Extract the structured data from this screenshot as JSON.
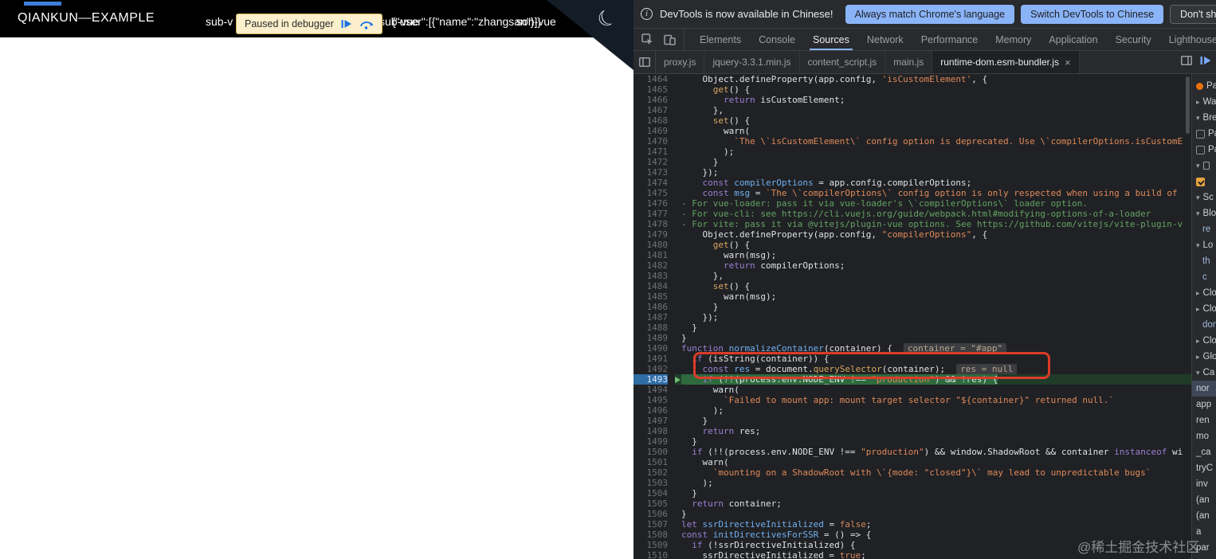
{
  "page": {
    "title": "QIANKUN—EXAMPLE",
    "nav_left": "sub-v",
    "overlap_texts": [
      "sub-vue",
      "{\"user\":[{\"name\":\"zhangsan\"}]}",
      "son-vue"
    ],
    "paused_banner": {
      "text": "Paused in debugger"
    }
  },
  "icons": {
    "close_icon": "×",
    "moon_icon": "☾",
    "info_icon": "i",
    "chevron_down": "▾",
    "chevron_right": "▸"
  },
  "devtools": {
    "infobar": {
      "message": "DevTools is now available in Chinese!",
      "buttons": [
        {
          "label": "Always match Chrome's language",
          "style": "primary"
        },
        {
          "label": "Switch DevTools to Chinese",
          "style": "primary"
        },
        {
          "label": "Don't show again",
          "style": "secondary"
        }
      ]
    },
    "main_tabs": {
      "items": [
        "Elements",
        "Console",
        "Sources",
        "Network",
        "Performance",
        "Memory",
        "Application",
        "Security",
        "Lighthouse"
      ],
      "selected": "Sources"
    },
    "file_tabs": [
      {
        "label": "proxy.js"
      },
      {
        "label": "jquery-3.3.1.min.js"
      },
      {
        "label": "content_script.js"
      },
      {
        "label": "main.js"
      },
      {
        "label": "runtime-dom.esm-bundler.js",
        "active": true,
        "closable": true
      }
    ],
    "editor": {
      "lines": [
        {
          "n": 1464,
          "s": [
            [
              "pl",
              "    Object.defineProperty(app.config, "
            ],
            [
              "str",
              "'isCustomElement'"
            ],
            [
              "pl",
              ", {"
            ]
          ]
        },
        {
          "n": 1465,
          "s": [
            [
              "pl",
              "      "
            ],
            [
              "prop",
              "get"
            ],
            [
              "pl",
              "() {"
            ]
          ]
        },
        {
          "n": 1466,
          "s": [
            [
              "pl",
              "        "
            ],
            [
              "kw",
              "return"
            ],
            [
              "pl",
              " isCustomElement;"
            ]
          ]
        },
        {
          "n": 1467,
          "s": [
            [
              "pl",
              "      },"
            ]
          ]
        },
        {
          "n": 1468,
          "s": [
            [
              "pl",
              "      "
            ],
            [
              "prop",
              "set"
            ],
            [
              "pl",
              "() {"
            ]
          ]
        },
        {
          "n": 1469,
          "s": [
            [
              "pl",
              "        warn("
            ]
          ]
        },
        {
          "n": 1470,
          "s": [
            [
              "pl",
              "          "
            ],
            [
              "str",
              "`The \\`isCustomElement\\` config option is deprecated. Use \\`compilerOptions.isCustomE"
            ]
          ]
        },
        {
          "n": 1471,
          "s": [
            [
              "pl",
              "        );"
            ]
          ]
        },
        {
          "n": 1472,
          "s": [
            [
              "pl",
              "      }"
            ]
          ]
        },
        {
          "n": 1473,
          "s": [
            [
              "pl",
              "    });"
            ]
          ]
        },
        {
          "n": 1474,
          "s": [
            [
              "pl",
              "    "
            ],
            [
              "kw",
              "const"
            ],
            [
              "pl",
              " "
            ],
            [
              "def",
              "compilerOptions"
            ],
            [
              "pl",
              " = app.config.compilerOptions;"
            ]
          ]
        },
        {
          "n": 1475,
          "s": [
            [
              "pl",
              "    "
            ],
            [
              "kw",
              "const"
            ],
            [
              "pl",
              " "
            ],
            [
              "def",
              "msg"
            ],
            [
              "pl",
              " = "
            ],
            [
              "str",
              "`The \\`compilerOptions\\` config option is only respected when using a build of"
            ]
          ]
        },
        {
          "n": 1476,
          "s": [
            [
              "grn",
              "- For vue-loader: pass it via vue-loader's \\`compilerOptions\\` loader option."
            ]
          ]
        },
        {
          "n": 1477,
          "s": [
            [
              "grn",
              "- For vue-cli: see https://cli.vuejs.org/guide/webpack.html#modifying-options-of-a-loader"
            ]
          ]
        },
        {
          "n": 1478,
          "s": [
            [
              "grn",
              "- For vite: pass it via @vitejs/plugin-vue options. See https://github.com/vitejs/vite-plugin-v"
            ]
          ]
        },
        {
          "n": 1479,
          "s": [
            [
              "pl",
              "    Object.defineProperty(app.config, "
            ],
            [
              "str",
              "\"compilerOptions\""
            ],
            [
              "pl",
              ", {"
            ]
          ]
        },
        {
          "n": 1480,
          "s": [
            [
              "pl",
              "      "
            ],
            [
              "prop",
              "get"
            ],
            [
              "pl",
              "() {"
            ]
          ]
        },
        {
          "n": 1481,
          "s": [
            [
              "pl",
              "        warn(msg);"
            ]
          ]
        },
        {
          "n": 1482,
          "s": [
            [
              "pl",
              "        "
            ],
            [
              "kw",
              "return"
            ],
            [
              "pl",
              " compilerOptions;"
            ]
          ]
        },
        {
          "n": 1483,
          "s": [
            [
              "pl",
              "      },"
            ]
          ]
        },
        {
          "n": 1484,
          "s": [
            [
              "pl",
              "      "
            ],
            [
              "prop",
              "set"
            ],
            [
              "pl",
              "() {"
            ]
          ]
        },
        {
          "n": 1485,
          "s": [
            [
              "pl",
              "        warn(msg);"
            ]
          ]
        },
        {
          "n": 1486,
          "s": [
            [
              "pl",
              "      }"
            ]
          ]
        },
        {
          "n": 1487,
          "s": [
            [
              "pl",
              "    });"
            ]
          ]
        },
        {
          "n": 1488,
          "s": [
            [
              "pl",
              "  }"
            ]
          ]
        },
        {
          "n": 1489,
          "s": [
            [
              "pl",
              "}"
            ]
          ]
        },
        {
          "n": 1490,
          "s": [
            [
              "kw",
              "function"
            ],
            [
              "pl",
              " "
            ],
            [
              "def",
              "normalizeContainer"
            ],
            [
              "pl",
              "(container) {"
            ],
            [
              "ev",
              "container = \"#app\""
            ]
          ]
        },
        {
          "n": 1491,
          "s": [
            [
              "pl",
              "  "
            ],
            [
              "kw",
              "if"
            ],
            [
              "pl",
              " (isString(container)) {"
            ]
          ]
        },
        {
          "n": 1492,
          "s": [
            [
              "pl",
              "    "
            ],
            [
              "kw",
              "const"
            ],
            [
              "pl",
              " "
            ],
            [
              "def",
              "res"
            ],
            [
              "pl",
              " = document."
            ],
            [
              "prop",
              "querySelector"
            ],
            [
              "pl",
              "(container);"
            ],
            [
              "ev",
              "res = null"
            ]
          ]
        },
        {
          "n": 1493,
          "exec": true,
          "s": [
            [
              "pl",
              "    "
            ],
            [
              "kw",
              "if"
            ],
            [
              "pl",
              " (!!(process.env.NODE_ENV !== "
            ],
            [
              "str",
              "\"production\""
            ],
            [
              "pl",
              ") && !res) {"
            ]
          ]
        },
        {
          "n": 1494,
          "s": [
            [
              "pl",
              "      warn("
            ]
          ]
        },
        {
          "n": 1495,
          "s": [
            [
              "pl",
              "        "
            ],
            [
              "str",
              "`Failed to mount app: mount target selector \"${container}\" returned null.`"
            ]
          ]
        },
        {
          "n": 1496,
          "s": [
            [
              "pl",
              "      );"
            ]
          ]
        },
        {
          "n": 1497,
          "s": [
            [
              "pl",
              "    }"
            ]
          ]
        },
        {
          "n": 1498,
          "s": [
            [
              "pl",
              "    "
            ],
            [
              "kw",
              "return"
            ],
            [
              "pl",
              " res;"
            ]
          ]
        },
        {
          "n": 1499,
          "s": [
            [
              "pl",
              "  }"
            ]
          ]
        },
        {
          "n": 1500,
          "s": [
            [
              "pl",
              "  "
            ],
            [
              "kw",
              "if"
            ],
            [
              "pl",
              " (!!(process.env.NODE_ENV !== "
            ],
            [
              "str",
              "\"production\""
            ],
            [
              "pl",
              ") && window.ShadowRoot && container "
            ],
            [
              "kw",
              "instanceof"
            ],
            [
              "pl",
              " wi"
            ]
          ]
        },
        {
          "n": 1501,
          "s": [
            [
              "pl",
              "    warn("
            ]
          ]
        },
        {
          "n": 1502,
          "s": [
            [
              "pl",
              "      "
            ],
            [
              "str",
              "`mounting on a ShadowRoot with \\`{mode: \"closed\"}\\` may lead to unpredictable bugs`"
            ]
          ]
        },
        {
          "n": 1503,
          "s": [
            [
              "pl",
              "    );"
            ]
          ]
        },
        {
          "n": 1504,
          "s": [
            [
              "pl",
              "  }"
            ]
          ]
        },
        {
          "n": 1505,
          "s": [
            [
              "pl",
              "  "
            ],
            [
              "kw",
              "return"
            ],
            [
              "pl",
              " container;"
            ]
          ]
        },
        {
          "n": 1506,
          "s": [
            [
              "pl",
              "}"
            ]
          ]
        },
        {
          "n": 1507,
          "s": [
            [
              "kw",
              "let"
            ],
            [
              "pl",
              " "
            ],
            [
              "def",
              "ssrDirectiveInitialized"
            ],
            [
              "pl",
              " = "
            ],
            [
              "atom",
              "false"
            ],
            [
              "pl",
              ";"
            ]
          ]
        },
        {
          "n": 1508,
          "s": [
            [
              "kw",
              "const"
            ],
            [
              "pl",
              " "
            ],
            [
              "def",
              "initDirectivesForSSR"
            ],
            [
              "pl",
              " = () => {"
            ]
          ]
        },
        {
          "n": 1509,
          "s": [
            [
              "pl",
              "  "
            ],
            [
              "kw",
              "if"
            ],
            [
              "pl",
              " (!ssrDirectiveInitialized) {"
            ]
          ]
        },
        {
          "n": 1510,
          "s": [
            [
              "pl",
              "    ssrDirectiveInitialized = "
            ],
            [
              "atom",
              "true"
            ],
            [
              "pl",
              ";"
            ]
          ]
        }
      ]
    },
    "sidebar": {
      "items": [
        {
          "dot": true,
          "label": "Pa"
        },
        {
          "arrow": "r",
          "label": "Wa"
        },
        {
          "arrow": "d",
          "label": "Bre"
        },
        {
          "box": "unchecked",
          "label": "Pa"
        },
        {
          "box": "unchecked",
          "label": "Pa"
        },
        {
          "arrow": "d",
          "file": true,
          "label": ""
        },
        {
          "box": "checked",
          "label": ""
        },
        {
          "arrow": "d",
          "label": "Sc"
        },
        {
          "arrow": "d",
          "label": "Blo"
        },
        {
          "label": "re",
          "var": true
        },
        {
          "arrow": "d",
          "label": "Lo"
        },
        {
          "label": "th",
          "var": true
        },
        {
          "label": "c",
          "var": true
        },
        {
          "arrow": "r",
          "label": "Clo"
        },
        {
          "arrow": "r",
          "label": "Clo"
        },
        {
          "label": "dom",
          "var": true
        },
        {
          "arrow": "r",
          "label": "Clo"
        },
        {
          "arrow": "r",
          "label": "Glo"
        },
        {
          "arrow": "d",
          "label": "Ca"
        },
        {
          "label": "nor",
          "current": true
        },
        {
          "label": "app"
        },
        {
          "label": "ren"
        },
        {
          "label": "mo"
        },
        {
          "label": "_ca"
        },
        {
          "label": "tryC"
        },
        {
          "label": "inv"
        },
        {
          "label": "(an"
        },
        {
          "label": "(an"
        },
        {
          "label": "a"
        },
        {
          "label": "par"
        }
      ]
    },
    "watermark": "@稀土掘金技术社区",
    "colors": {
      "accent_blue": "#8ab4f8",
      "paused_line_green": "#2f6a3e",
      "annotation_red": "#dd3b2a",
      "breakpoint_orange": "#e8a33d",
      "banner_yellow": "#fbf0cb"
    }
  }
}
